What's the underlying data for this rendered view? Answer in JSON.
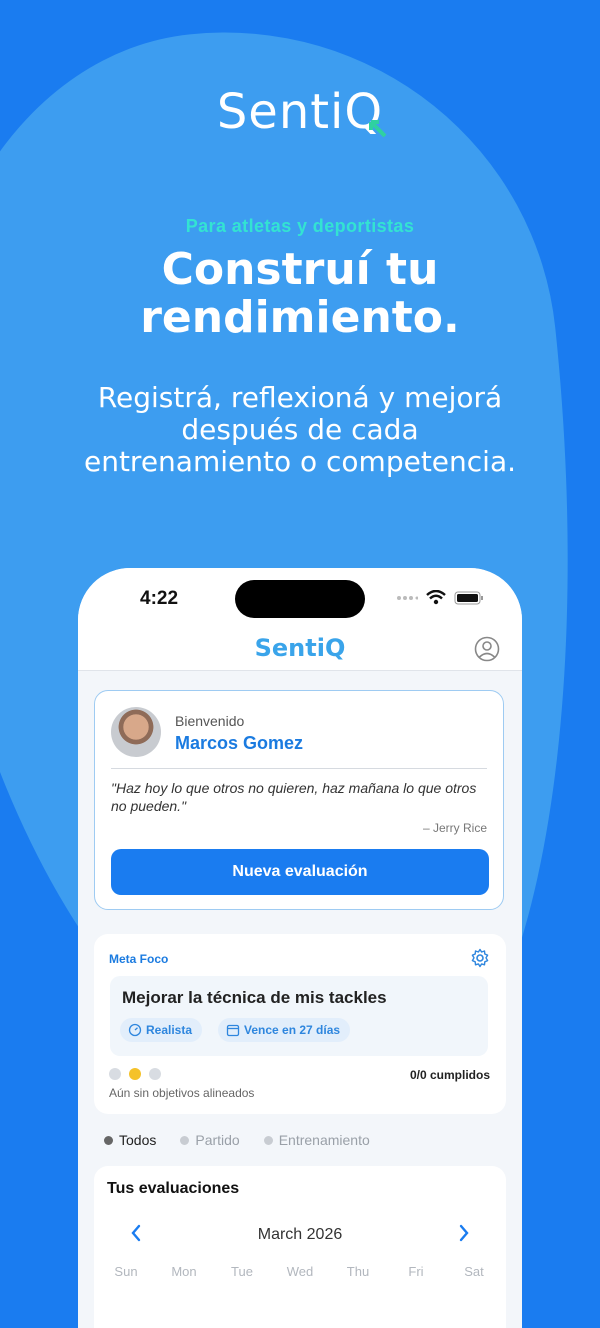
{
  "brand": {
    "logo_text": "Senti",
    "logo_q": "Q",
    "accent": "#1a7cf0",
    "teal": "#33e3d2"
  },
  "hero": {
    "tagline": "Para atletas y deportistas",
    "headline_line1": "Construí tu",
    "headline_line2": "rendimiento.",
    "sub_line1": "Registrá, reflexioná y mejorá",
    "sub_line2": "después de cada",
    "sub_line3": "entrenamiento o competencia."
  },
  "status_bar": {
    "time": "4:22"
  },
  "app_bar": {
    "logo_text": "Senti",
    "logo_q": "Q",
    "profile_icon": "user-circle-icon"
  },
  "welcome": {
    "label": "Bienvenido",
    "name": "Marcos Gomez",
    "quote": "\"Haz hoy lo que otros no quieren, haz mañana lo que otros no pueden.\"",
    "author": "– Jerry Rice",
    "button": "Nueva evaluación"
  },
  "focus": {
    "title": "Meta Foco",
    "goal": "Mejorar la técnica de mis tackles",
    "chip_realistic": "Realista",
    "chip_due": "Vence en 27 días",
    "fulfilled": "0/0 cumplidos",
    "aligned": "Aún sin objetivos alineados"
  },
  "filters": {
    "all": "Todos",
    "match": "Partido",
    "training": "Entrenamiento"
  },
  "evaluations": {
    "title": "Tus evaluaciones",
    "month": "March 2026",
    "weekdays": [
      "Sun",
      "Mon",
      "Tue",
      "Wed",
      "Thu",
      "Fri",
      "Sat"
    ]
  }
}
